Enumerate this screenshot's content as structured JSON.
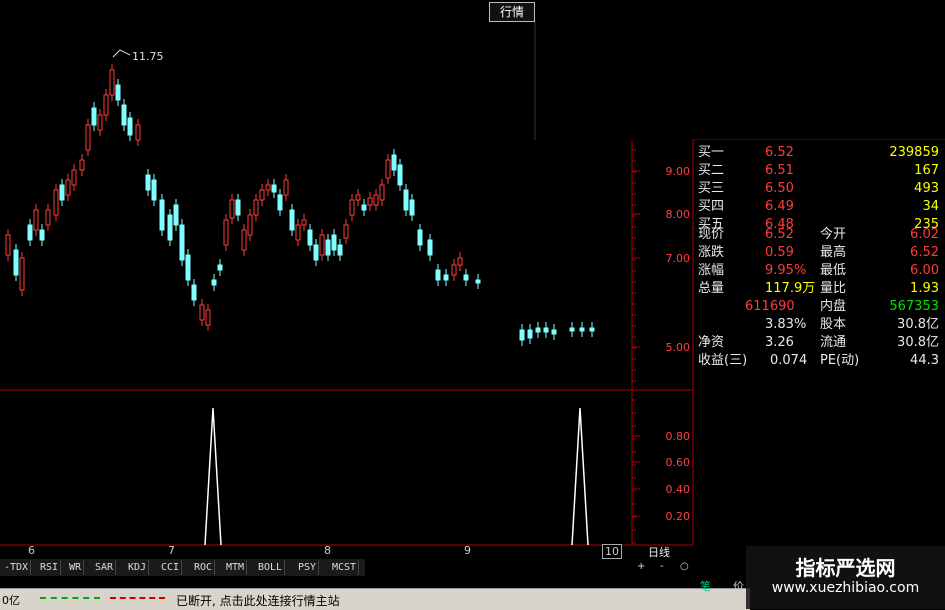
{
  "titlebar": {
    "stock_name": "",
    "tab_quote": "行情"
  },
  "price_axis": [
    "9.00",
    "8.00",
    "7.00",
    "5.00"
  ],
  "indicator_axis": [
    "0.80",
    "0.60",
    "0.40",
    "0.20"
  ],
  "high_label": "11.75",
  "x_labels": [
    "6",
    "7",
    "8",
    "9",
    "10"
  ],
  "period_label": "日线",
  "indicator_tabs": [
    "-TDX",
    "RSI",
    "WR",
    "SAR",
    "KDJ",
    "CCI",
    "ROC",
    "MTM",
    "BOLL",
    "PSY",
    "MCST"
  ],
  "nav_buttons": [
    "+",
    "-",
    "○"
  ],
  "quote": {
    "bids": [
      {
        "label": "买一",
        "price": "6.52",
        "vol": "239859"
      },
      {
        "label": "买二",
        "price": "6.51",
        "vol": "167"
      },
      {
        "label": "买三",
        "price": "6.50",
        "vol": "493"
      },
      {
        "label": "买四",
        "price": "6.49",
        "vol": "34"
      },
      {
        "label": "买五",
        "price": "6.48",
        "vol": "235"
      }
    ],
    "stats": [
      {
        "l1": "现价",
        "v1": "6.52",
        "l2": "今开",
        "v2": "6.02"
      },
      {
        "l1": "涨跌",
        "v1": "0.59",
        "l2": "最高",
        "v2": "6.52"
      },
      {
        "l1": "涨幅",
        "v1": "9.95%",
        "l2": "最低",
        "v2": "6.00"
      },
      {
        "l1": "总量",
        "v1": "117.9万",
        "l2": "量比",
        "v2": "1.93"
      },
      {
        "l1": "",
        "v1": "611690",
        "l2": "内盘",
        "v2": "567353"
      },
      {
        "l1": "",
        "v1": "3.83%",
        "l2": "股本",
        "v2": "30.8亿"
      },
      {
        "l1": "净资",
        "v1": "3.26",
        "l2": "流通",
        "v2": "30.8亿"
      },
      {
        "l1": "收益(三)",
        "v1": "0.074",
        "l2": "PE(动)",
        "v2": "44.3"
      }
    ]
  },
  "status": {
    "left": "0亿",
    "message": "已断开, 点击此处连接行情主站"
  },
  "watermark": {
    "title": "指标严选网",
    "url": "www.xuezhibiao.com"
  },
  "bottom_tab": "笔",
  "bottom_tab2": "价",
  "colors": {
    "up": "#ff3b3b",
    "down": "#7fffff",
    "axis": "#b00000",
    "indicator": "#ffffff"
  }
}
